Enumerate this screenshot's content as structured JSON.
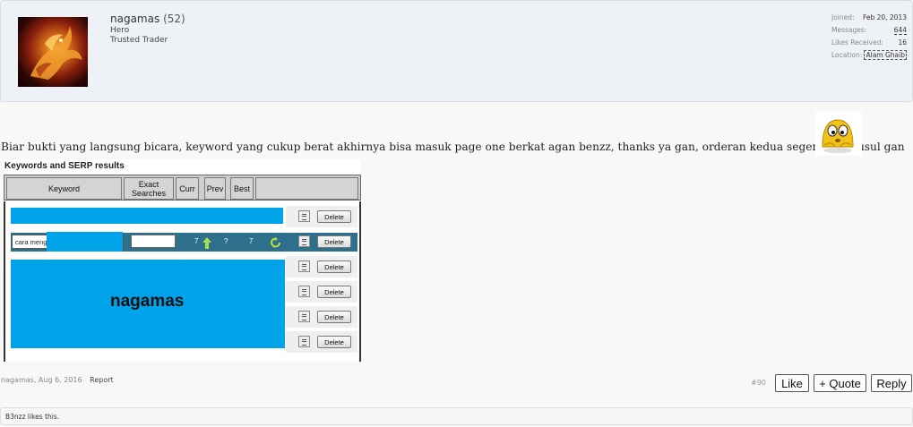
{
  "user": {
    "name": "nagamas",
    "count": "(52)",
    "title_primary": "Hero",
    "title_secondary": "Trusted Trader",
    "stats": [
      {
        "label": "Joined:",
        "value": "Feb 20, 2013"
      },
      {
        "label": "Messages:",
        "value": "644"
      },
      {
        "label": "Likes Received:",
        "value": "16"
      },
      {
        "label": "Location:",
        "value": "Alam Ghaib"
      }
    ]
  },
  "post": {
    "message": "Biar bukti yang langsung bicara, keyword yang cukup berat akhirnya bisa masuk page one berkat agan benzz, thanks ya gan, orderan kedua segera menyusul gan",
    "smiley_icon": "smiley-icon"
  },
  "serp": {
    "title": "Keywords and SERP results",
    "headers": [
      "Keyword",
      "Exact Searches",
      "Curr",
      "Prev",
      "Best"
    ],
    "highlight_row": {
      "keyword": "cara meng",
      "curr": "7",
      "prev": "?",
      "best": "7"
    },
    "delete_label": "Delete",
    "watermark": "nagamas"
  },
  "footer": {
    "author_date": "nagamas, Aug 6, 2016",
    "report": "Report",
    "post_number": "#90",
    "like": "Like",
    "quote": "+ Quote",
    "reply": "Reply",
    "likes_text": "B3nzz likes this."
  },
  "colors": {
    "accent_blue": "#00a2e8",
    "row_highlight": "#2e6f8c",
    "user_box_bg": "#eef2f7"
  }
}
